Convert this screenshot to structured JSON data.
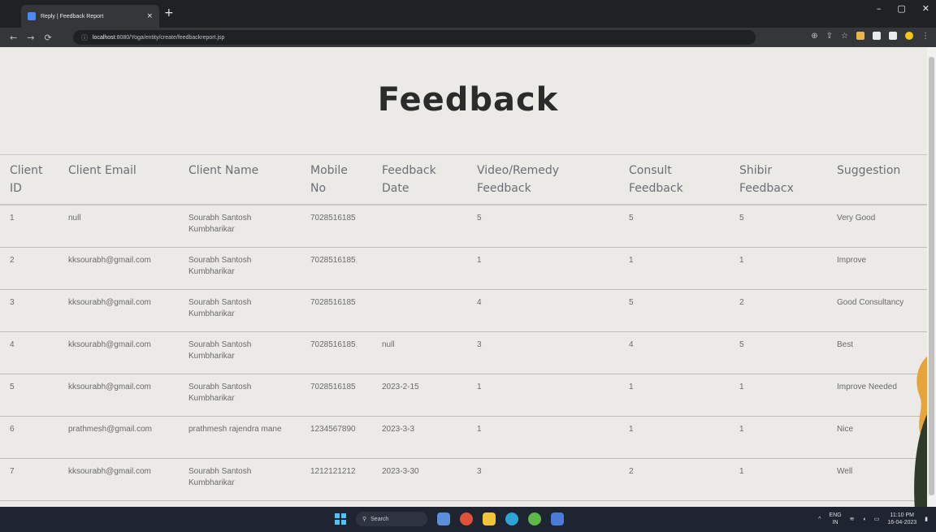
{
  "browser": {
    "tab_title": "Reply | Feedback Report",
    "tab_close": "×",
    "new_tab": "+",
    "url_host": "localhost",
    "url_path": ":8080/Yoga/entity/create/feedbackreport.jsp",
    "win_min": "–",
    "win_max": "▢",
    "win_close": "✕"
  },
  "page": {
    "title": "Feedback"
  },
  "table": {
    "headers": {
      "client_id": [
        "Client",
        "ID"
      ],
      "client_email": "Client Email",
      "client_name": "Client Name",
      "mobile": [
        "Mobile",
        "No"
      ],
      "feedback_date": [
        "Feedback",
        "Date"
      ],
      "video_feedback": [
        "Video/Remedy",
        "Feedback"
      ],
      "consult_feedback": [
        "Consult",
        "Feedback"
      ],
      "shibir_feedback": [
        "Shibir",
        "Feedbacx"
      ],
      "suggestion": "Suggestion"
    },
    "rows": [
      {
        "id": "1",
        "email": "null",
        "name": "Sourabh Santosh Kumbharikar",
        "mobile": "7028516185",
        "date": "",
        "video": "5",
        "consult": "5",
        "shibir": "5",
        "suggestion": "Very Good"
      },
      {
        "id": "2",
        "email": "kksourabh@gmail.com",
        "name": "Sourabh Santosh Kumbharikar",
        "mobile": "7028516185",
        "date": "",
        "video": "1",
        "consult": "1",
        "shibir": "1",
        "suggestion": "Improve"
      },
      {
        "id": "3",
        "email": "kksourabh@gmail.com",
        "name": "Sourabh Santosh Kumbharikar",
        "mobile": "7028516185",
        "date": "",
        "video": "4",
        "consult": "5",
        "shibir": "2",
        "suggestion": "Good Consultancy"
      },
      {
        "id": "4",
        "email": "kksourabh@gmail.com",
        "name": "Sourabh Santosh Kumbharikar",
        "mobile": "7028516185",
        "date": "null",
        "video": "3",
        "consult": "4",
        "shibir": "5",
        "suggestion": "Best"
      },
      {
        "id": "5",
        "email": "kksourabh@gmail.com",
        "name": "Sourabh Santosh Kumbharikar",
        "mobile": "7028516185",
        "date": "2023-2-15",
        "video": "1",
        "consult": "1",
        "shibir": "1",
        "suggestion": "Improve Needed"
      },
      {
        "id": "6",
        "email": "prathmesh@gmail.com",
        "name": "prathmesh rajendra mane",
        "mobile": "1234567890",
        "date": "2023-3-3",
        "video": "1",
        "consult": "1",
        "shibir": "1",
        "suggestion": "Nice"
      },
      {
        "id": "7",
        "email": "kksourabh@gmail.com",
        "name": "Sourabh Santosh Kumbharikar",
        "mobile": "1212121212",
        "date": "2023-3-30",
        "video": "3",
        "consult": "2",
        "shibir": "1",
        "suggestion": "Well"
      }
    ]
  },
  "taskbar": {
    "search_placeholder": "Search",
    "lang_top": "ENG",
    "lang_bottom": "IN",
    "time": "11:10 PM",
    "date": "16-04-2023"
  },
  "colors": {
    "page_bg": "#ebeae6",
    "browser_bg": "#202124",
    "taskbar_bg": "#1f2530"
  }
}
